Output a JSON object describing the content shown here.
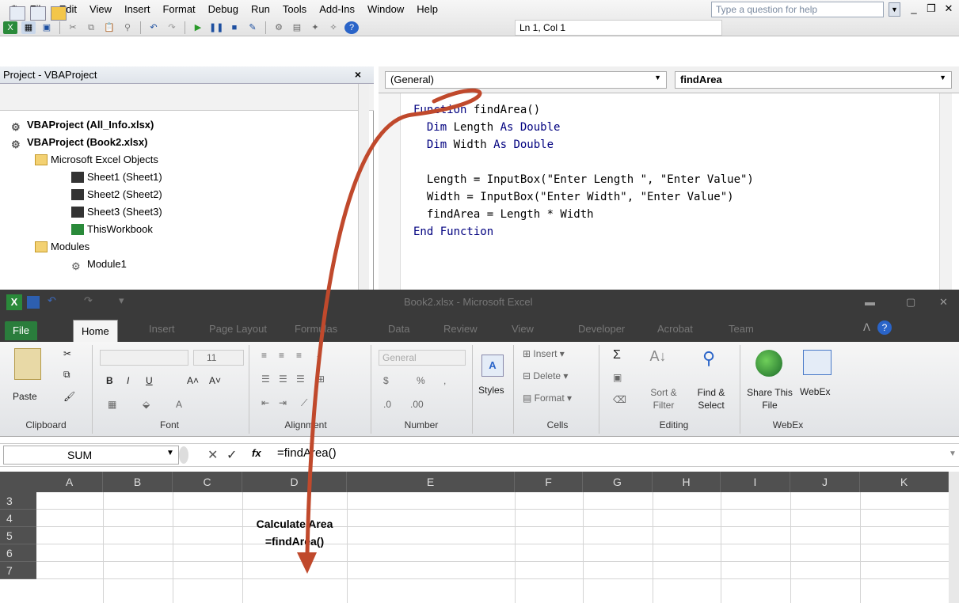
{
  "vbe": {
    "menu": [
      "File",
      "Edit",
      "View",
      "Insert",
      "Format",
      "Debug",
      "Run",
      "Tools",
      "Add-Ins",
      "Window",
      "Help"
    ],
    "help_placeholder": "Type a question for help",
    "status": "Ln 1, Col 1"
  },
  "project": {
    "title": "Project - VBAProject",
    "tree": [
      "VBAProject (All_Info.xlsx)",
      "VBAProject (Book2.xlsx)",
      "Microsoft Excel Objects",
      "Sheet1 (Sheet1)",
      "Sheet2 (Sheet2)",
      "Sheet3 (Sheet3)",
      "ThisWorkbook",
      "Modules",
      "Module1"
    ]
  },
  "code": {
    "object_combo": "(General)",
    "proc_combo": "findArea",
    "lines": [
      {
        "kw": "Function ",
        "rest": "findArea()"
      },
      {
        "kw": "  Dim ",
        "rest": "Length ",
        "kw2": "As Double"
      },
      {
        "kw": "  Dim ",
        "rest": "Width ",
        "kw2": "As Double"
      },
      {
        "kw": "",
        "rest": ""
      },
      {
        "kw": "",
        "rest": "  Length = InputBox(\"Enter Length \", \"Enter Value\")"
      },
      {
        "kw": "",
        "rest": "  Width = InputBox(\"Enter Width\", \"Enter Value\")"
      },
      {
        "kw": "",
        "rest": "  findArea = Length * Width"
      },
      {
        "kw": "End Function",
        "rest": ""
      }
    ]
  },
  "excel": {
    "title": "Book2.xlsx - Microsoft Excel",
    "tabs": [
      "File",
      "Home",
      "Insert",
      "Page Layout",
      "Formulas",
      "Data",
      "Review",
      "View",
      "Developer",
      "Acrobat",
      "Team"
    ],
    "groups": [
      "Clipboard",
      "Font",
      "Alignment",
      "Number",
      "Cells",
      "Editing",
      "WebEx"
    ],
    "paste": "Paste",
    "styles": "Styles",
    "number_format": "General",
    "font_size": "11",
    "cells": [
      "Insert",
      "Delete",
      "Format"
    ],
    "editing": {
      "sort": "Sort & Filter",
      "find": "Find & Select"
    },
    "webex": {
      "share": "Share This File",
      "webex": "WebEx"
    },
    "name_box": "SUM",
    "formula": "=findArea()",
    "columns": [
      "A",
      "B",
      "C",
      "D",
      "E",
      "F",
      "G",
      "H",
      "I",
      "J",
      "K"
    ],
    "rows": [
      "3",
      "4",
      "5",
      "6",
      "7"
    ],
    "cell_d4": "Calculate Area",
    "cell_d5": "=findArea()"
  },
  "colors": {
    "keyword": "#00007f",
    "arrow": "#c0492c",
    "excel_green": "#2a7d3c"
  }
}
